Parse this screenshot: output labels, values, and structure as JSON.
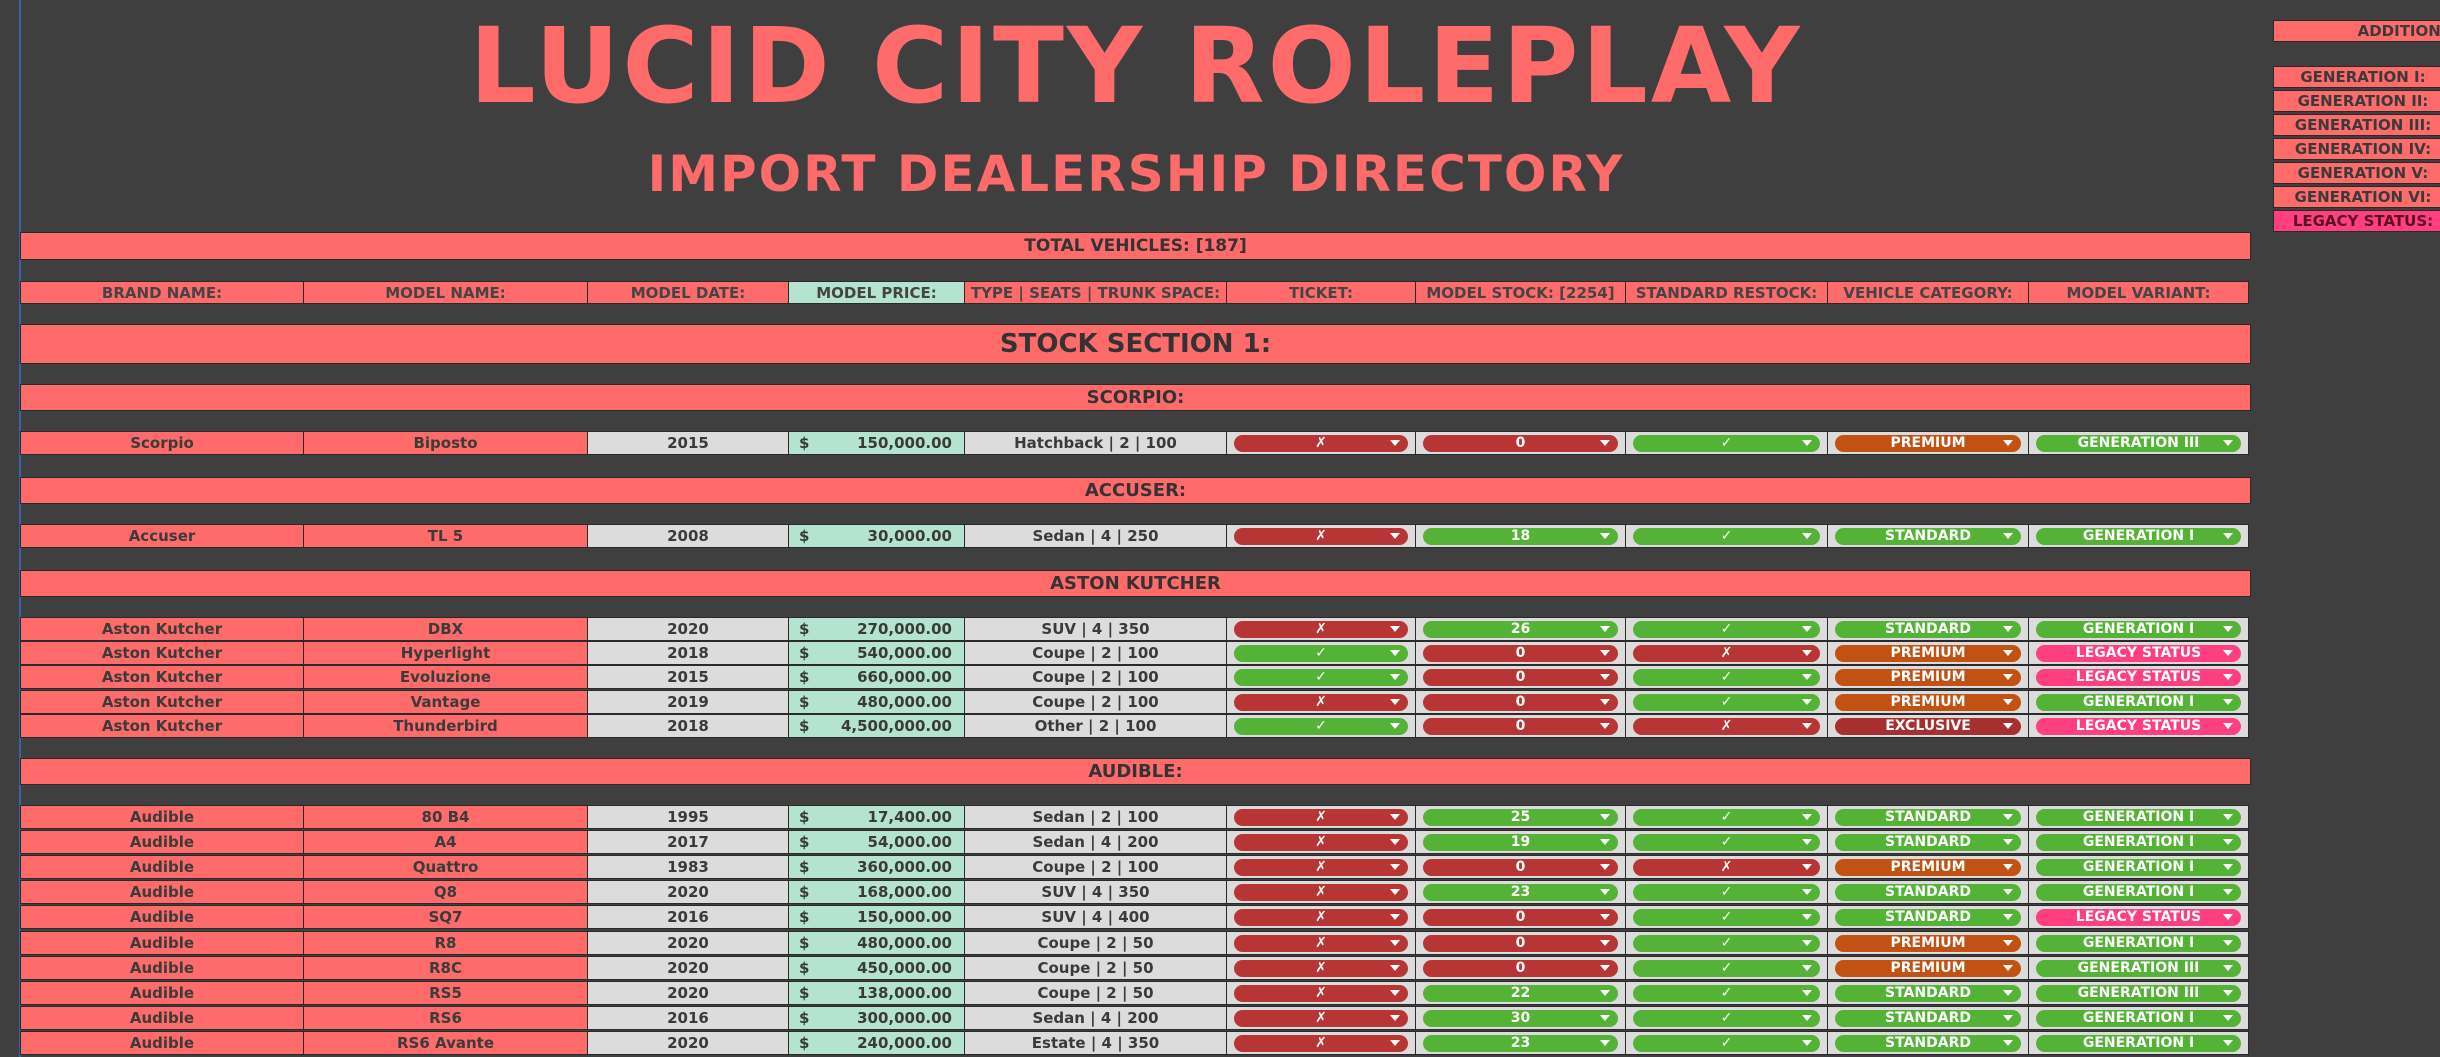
{
  "title": "LUCID CITY ROLEPLAY",
  "subtitle": "IMPORT DEALERSHIP DIRECTORY",
  "total_vehicles": "TOTAL VEHICLES: [187]",
  "headers": [
    "BRAND NAME:",
    "MODEL NAME:",
    "MODEL DATE:",
    "MODEL PRICE:",
    "TYPE | SEATS | TRUNK SPACE:",
    "TICKET:",
    "MODEL STOCK: [2254]",
    "STANDARD RESTOCK:",
    "VEHICLE CATEGORY:",
    "MODEL VARIANT:"
  ],
  "section_title": "STOCK SECTION 1:",
  "currency_symbol": "$",
  "groups": [
    {
      "name": "SCORPIO:",
      "rows": [
        {
          "brand": "Scorpio",
          "model": "Biposto",
          "date": "2015",
          "price": "150,000.00",
          "type": "Hatchback | 2 | 100",
          "ticket": "✗",
          "stock": "0",
          "restock": "✓",
          "category": "PREMIUM",
          "variant": "GENERATION III"
        }
      ]
    },
    {
      "name": "ACCUSER:",
      "rows": [
        {
          "brand": "Accuser",
          "model": "TL 5",
          "date": "2008",
          "price": "30,000.00",
          "type": "Sedan | 4 | 250",
          "ticket": "✗",
          "stock": "18",
          "restock": "✓",
          "category": "STANDARD",
          "variant": "GENERATION I"
        }
      ]
    },
    {
      "name": "ASTON KUTCHER",
      "rows": [
        {
          "brand": "Aston Kutcher",
          "model": "DBX",
          "date": "2020",
          "price": "270,000.00",
          "type": "SUV | 4 | 350",
          "ticket": "✗",
          "stock": "26",
          "restock": "✓",
          "category": "STANDARD",
          "variant": "GENERATION I"
        },
        {
          "brand": "Aston Kutcher",
          "model": "Hyperlight",
          "date": "2018",
          "price": "540,000.00",
          "type": "Coupe | 2 | 100",
          "ticket": "✓",
          "stock": "0",
          "restock": "✗",
          "category": "PREMIUM",
          "variant": "LEGACY STATUS"
        },
        {
          "brand": "Aston Kutcher",
          "model": "Evoluzione",
          "date": "2015",
          "price": "660,000.00",
          "type": "Coupe | 2 | 100",
          "ticket": "✓",
          "stock": "0",
          "restock": "✓",
          "category": "PREMIUM",
          "variant": "LEGACY STATUS"
        },
        {
          "brand": "Aston Kutcher",
          "model": "Vantage",
          "date": "2019",
          "price": "480,000.00",
          "type": "Coupe | 2 | 100",
          "ticket": "✗",
          "stock": "0",
          "restock": "✓",
          "category": "PREMIUM",
          "variant": "GENERATION I"
        },
        {
          "brand": "Aston Kutcher",
          "model": "Thunderbird",
          "date": "2018",
          "price": "4,500,000.00",
          "type": "Other | 2 | 100",
          "ticket": "✓",
          "stock": "0",
          "restock": "✗",
          "category": "EXCLUSIVE",
          "variant": "LEGACY STATUS"
        }
      ]
    },
    {
      "name": "AUDIBLE:",
      "rows": [
        {
          "brand": "Audible",
          "model": "80 B4",
          "date": "1995",
          "price": "17,400.00",
          "type": "Sedan | 2 | 100",
          "ticket": "✗",
          "stock": "25",
          "restock": "✓",
          "category": "STANDARD",
          "variant": "GENERATION I"
        },
        {
          "brand": "Audible",
          "model": "A4",
          "date": "2017",
          "price": "54,000.00",
          "type": "Sedan | 4 | 200",
          "ticket": "✗",
          "stock": "19",
          "restock": "✓",
          "category": "STANDARD",
          "variant": "GENERATION I"
        },
        {
          "brand": "Audible",
          "model": "Quattro",
          "date": "1983",
          "price": "360,000.00",
          "type": "Coupe | 2 | 100",
          "ticket": "✗",
          "stock": "0",
          "restock": "✗",
          "category": "PREMIUM",
          "variant": "GENERATION I"
        },
        {
          "brand": "Audible",
          "model": "Q8",
          "date": "2020",
          "price": "168,000.00",
          "type": "SUV | 4 | 350",
          "ticket": "✗",
          "stock": "23",
          "restock": "✓",
          "category": "STANDARD",
          "variant": "GENERATION I"
        },
        {
          "brand": "Audible",
          "model": "SQ7",
          "date": "2016",
          "price": "150,000.00",
          "type": "SUV | 4 | 400",
          "ticket": "✗",
          "stock": "0",
          "restock": "✓",
          "category": "STANDARD",
          "variant": "LEGACY STATUS"
        },
        {
          "brand": "Audible",
          "model": "R8",
          "date": "2020",
          "price": "480,000.00",
          "type": "Coupe | 2 | 50",
          "ticket": "✗",
          "stock": "0",
          "restock": "✓",
          "category": "PREMIUM",
          "variant": "GENERATION I"
        },
        {
          "brand": "Audible",
          "model": "R8C",
          "date": "2020",
          "price": "450,000.00",
          "type": "Coupe | 2 | 50",
          "ticket": "✗",
          "stock": "0",
          "restock": "✓",
          "category": "PREMIUM",
          "variant": "GENERATION III"
        },
        {
          "brand": "Audible",
          "model": "RS5",
          "date": "2020",
          "price": "138,000.00",
          "type": "Coupe | 2 | 50",
          "ticket": "✗",
          "stock": "22",
          "restock": "✓",
          "category": "STANDARD",
          "variant": "GENERATION III"
        },
        {
          "brand": "Audible",
          "model": "RS6",
          "date": "2016",
          "price": "300,000.00",
          "type": "Sedan | 4 | 200",
          "ticket": "✗",
          "stock": "30",
          "restock": "✓",
          "category": "STANDARD",
          "variant": "GENERATION I"
        },
        {
          "brand": "Audible",
          "model": "RS6 Avante",
          "date": "2020",
          "price": "240,000.00",
          "type": "Estate | 4 | 350",
          "ticket": "✗",
          "stock": "23",
          "restock": "✓",
          "category": "STANDARD",
          "variant": "GENERATION I"
        }
      ]
    }
  ],
  "side_panel": {
    "header": "ADDITIONAL",
    "items": [
      "GENERATION I:",
      "GENERATION II:",
      "GENERATION III:",
      "GENERATION IV:",
      "GENERATION V:",
      "GENERATION VI:",
      "LEGACY STATUS:"
    ]
  },
  "colors": {
    "accent_red": "#ff6b6b",
    "price_mint": "#b4e3cf",
    "background": "#3f3f3f",
    "pill_red": "#b73535",
    "pill_green": "#54b336",
    "pill_orange": "#c25214",
    "pill_darkred": "#a82f2f",
    "pill_pink": "#ff3f7f"
  }
}
